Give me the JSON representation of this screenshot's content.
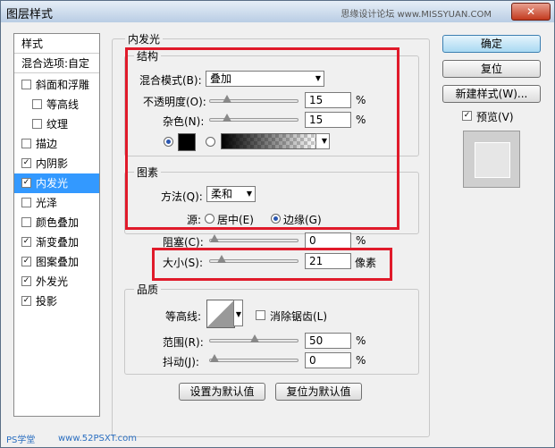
{
  "window": {
    "title": "图层样式",
    "watermark": "思缘设计论坛 www.MISSYUAN.COM",
    "close_label": "✕"
  },
  "left_panel": {
    "header": "样式",
    "blend_options": "混合选项:自定",
    "items": [
      {
        "label": "斜面和浮雕",
        "checked": false,
        "indent": false,
        "selected": false
      },
      {
        "label": "等高线",
        "checked": false,
        "indent": true,
        "selected": false
      },
      {
        "label": "纹理",
        "checked": false,
        "indent": true,
        "selected": false
      },
      {
        "label": "描边",
        "checked": false,
        "indent": false,
        "selected": false
      },
      {
        "label": "内阴影",
        "checked": true,
        "indent": false,
        "selected": false
      },
      {
        "label": "内发光",
        "checked": true,
        "indent": false,
        "selected": true
      },
      {
        "label": "光泽",
        "checked": false,
        "indent": false,
        "selected": false
      },
      {
        "label": "颜色叠加",
        "checked": false,
        "indent": false,
        "selected": false
      },
      {
        "label": "渐变叠加",
        "checked": true,
        "indent": false,
        "selected": false
      },
      {
        "label": "图案叠加",
        "checked": true,
        "indent": false,
        "selected": false
      },
      {
        "label": "外发光",
        "checked": true,
        "indent": false,
        "selected": false
      },
      {
        "label": "投影",
        "checked": true,
        "indent": false,
        "selected": false
      }
    ]
  },
  "inner_glow": {
    "title": "内发光",
    "structure": {
      "title": "结构",
      "blend_mode_label": "混合模式(B):",
      "blend_mode_value": "叠加",
      "opacity_label": "不透明度(O):",
      "opacity_value": "15",
      "opacity_level": 0.15,
      "noise_label": "杂色(N):",
      "noise_value": "15",
      "noise_level": 0.15,
      "percent": "%",
      "color": "#000000",
      "color_mode": "solid"
    },
    "elements": {
      "title": "图素",
      "method_label": "方法(Q):",
      "method_value": "柔和",
      "source_label": "源:",
      "source_center": "居中(E)",
      "source_edge": "边缘(G)",
      "source_selected": "edge",
      "choke_label": "阻塞(C):",
      "choke_value": "0",
      "choke_level": 0,
      "size_label": "大小(S):",
      "size_value": "21",
      "size_level": 0.09,
      "size_unit": "像素",
      "percent": "%"
    },
    "quality": {
      "title": "品质",
      "contour_label": "等高线:",
      "anti_alias_label": "消除锯齿(L)",
      "anti_alias": false,
      "range_label": "范围(R):",
      "range_value": "50",
      "range_level": 0.5,
      "jitter_label": "抖动(J):",
      "jitter_value": "0",
      "jitter_level": 0,
      "percent": "%"
    },
    "make_default": "设置为默认值",
    "reset_default": "复位为默认值"
  },
  "right": {
    "ok": "确定",
    "reset": "复位",
    "new_style": "新建样式(W)...",
    "preview_label": "预览(V)",
    "preview_checked": true
  },
  "footer": {
    "left": "PS学堂",
    "right": "www.52PSXT.com"
  },
  "colors": {
    "highlight": "#e01a2a",
    "selection": "#3399ff"
  }
}
